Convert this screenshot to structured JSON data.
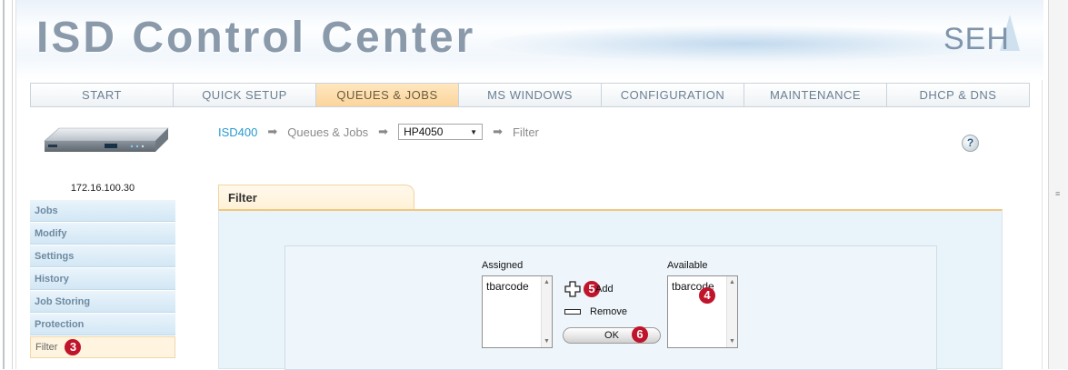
{
  "app": {
    "title": "ISD Control Center",
    "logo": "SEH"
  },
  "nav": {
    "tabs": [
      {
        "label": "START"
      },
      {
        "label": "QUICK SETUP"
      },
      {
        "label": "QUEUES & JOBS"
      },
      {
        "label": "MS WINDOWS"
      },
      {
        "label": "CONFIGURATION"
      },
      {
        "label": "MAINTENANCE"
      },
      {
        "label": "DHCP & DNS"
      }
    ],
    "active": "QUEUES & JOBS"
  },
  "sidebar": {
    "device_ip": "172.16.100.30",
    "items": [
      {
        "label": "Jobs"
      },
      {
        "label": "Modify"
      },
      {
        "label": "Settings"
      },
      {
        "label": "History"
      },
      {
        "label": "Job Storing"
      },
      {
        "label": "Protection"
      },
      {
        "label": "Filter"
      }
    ],
    "active": "Filter"
  },
  "breadcrumb": {
    "root": "ISD400",
    "section": "Queues & Jobs",
    "printer_select": "HP4050",
    "page": "Filter",
    "arrow_glyph": "➡"
  },
  "help": {
    "label": "?"
  },
  "panel": {
    "tab_title": "Filter",
    "assigned_label": "Assigned",
    "available_label": "Available",
    "assigned_items": [
      "tbarcode"
    ],
    "available_items": [
      "tbarcode"
    ],
    "add_label": "Add",
    "remove_label": "Remove",
    "ok_label": "OK"
  },
  "callouts": {
    "filter": "3",
    "available": "4",
    "add": "5",
    "ok": "6"
  },
  "colors": {
    "accent_active_tab": "#fbd59c",
    "link_blue": "#2a9ad0",
    "callout_red": "#c0142b",
    "panel_bg": "#e9f3fa"
  }
}
